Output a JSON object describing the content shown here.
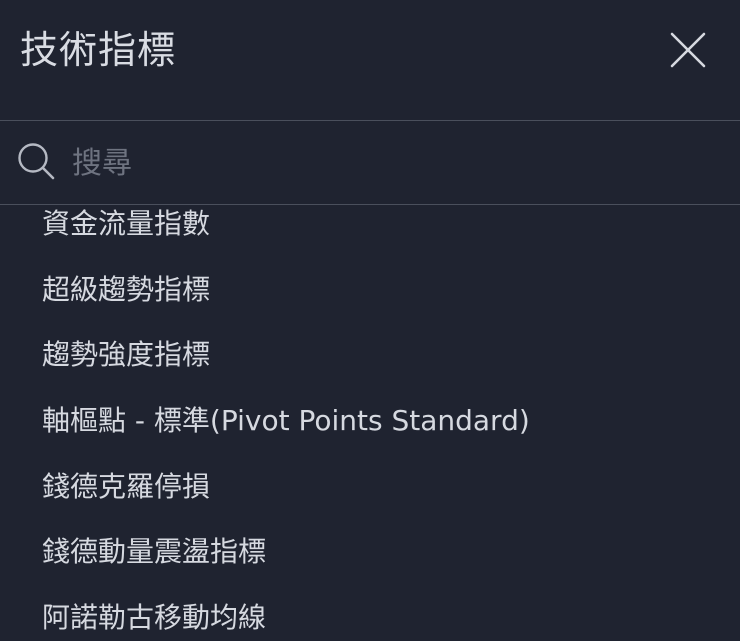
{
  "header": {
    "title": "技術指標",
    "close_icon": "close-icon"
  },
  "search": {
    "icon": "search-icon",
    "placeholder": "搜尋",
    "value": ""
  },
  "indicators": [
    {
      "label": "資金流量指數"
    },
    {
      "label": "超級趨勢指標"
    },
    {
      "label": "趨勢強度指標"
    },
    {
      "label": "軸樞點 - 標準(Pivot Points Standard)"
    },
    {
      "label": "錢德克羅停損"
    },
    {
      "label": "錢德動量震盪指標"
    },
    {
      "label": "阿諾勒古移動均線"
    }
  ],
  "colors": {
    "background": "#1f2330",
    "text": "#d6d9e0",
    "divider": "#4a4f5c",
    "placeholder": "#6e7380"
  }
}
